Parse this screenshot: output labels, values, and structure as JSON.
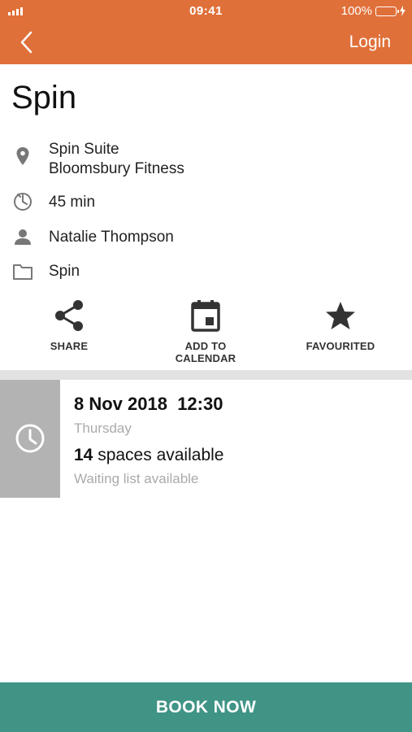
{
  "status_bar": {
    "time": "09:41",
    "battery": "100%"
  },
  "header": {
    "login_label": "Login",
    "brand_color": "#e0703a"
  },
  "class": {
    "title": "Spin",
    "location_line1": "Spin Suite",
    "location_line2": "Bloomsbury Fitness",
    "duration": "45 min",
    "instructor": "Natalie Thompson",
    "category": "Spin"
  },
  "actions": {
    "share_label": "SHARE",
    "calendar_label": "ADD TO CALENDAR",
    "favourite_label": "FAVOURITED"
  },
  "session": {
    "date_time": "8 Nov 2018  12:30",
    "day": "Thursday",
    "spaces_count": "14",
    "spaces_text": "spaces available",
    "waiting_list": "Waiting list available"
  },
  "footer": {
    "book_label": "BOOK NOW",
    "book_color": "#3f9486"
  },
  "icons": [
    "back-chevron-icon",
    "location-pin-icon",
    "timer-icon",
    "person-icon",
    "folder-icon",
    "share-icon",
    "calendar-icon",
    "star-icon",
    "clock-icon"
  ]
}
